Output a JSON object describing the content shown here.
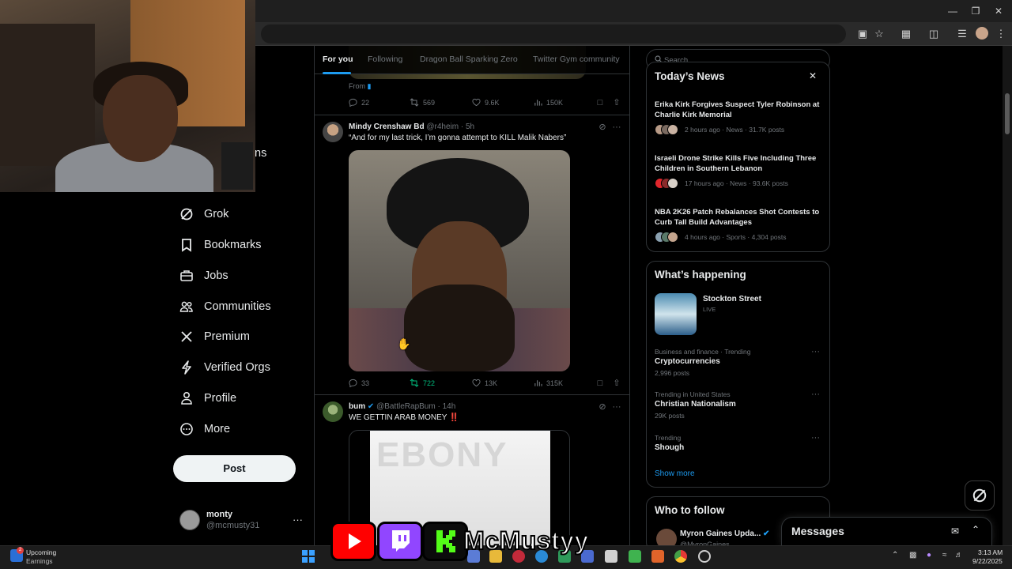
{
  "nav": {
    "partial_label": "ns",
    "items": [
      {
        "label": "Grok",
        "icon": "grok-icon"
      },
      {
        "label": "Bookmarks",
        "icon": "bookmark-icon"
      },
      {
        "label": "Jobs",
        "icon": "briefcase-icon"
      },
      {
        "label": "Communities",
        "icon": "communities-icon"
      },
      {
        "label": "Premium",
        "icon": "x-logo-icon"
      },
      {
        "label": "Verified Orgs",
        "icon": "lightning-icon"
      },
      {
        "label": "Profile",
        "icon": "person-icon"
      },
      {
        "label": "More",
        "icon": "more-circle-icon"
      }
    ],
    "post_label": "Post",
    "account": {
      "name": "monty",
      "handle": "@mcmusty31"
    }
  },
  "feed": {
    "tabs": [
      "For you",
      "Following",
      "Dragon Ball Sparking Zero",
      "Twitter Gym community"
    ],
    "top_post": {
      "from_label": "From",
      "replies": "22",
      "reposts": "569",
      "likes": "9.6K",
      "views": "150K"
    },
    "posts": [
      {
        "name": "Mindy Crenshaw Bd",
        "handle": "@r4heim",
        "time": "· 5h",
        "text": "“And for my last trick, I’m gonna attempt to KILL Malik Nabers”",
        "replies": "33",
        "reposts": "722",
        "likes": "13K",
        "views": "315K"
      },
      {
        "name": "bum",
        "handle": "@BattleRapBum",
        "time": "· 14h",
        "text": "WE GETTIN ARAB MONEY ‼️",
        "media_word": "EBONY"
      }
    ]
  },
  "sidebar": {
    "search_placeholder": "Search",
    "news": {
      "title": "Today’s News",
      "items": [
        {
          "title": "Erika Kirk Forgives Suspect Tyler Robinson at Charlie Kirk Memorial",
          "meta": "2 hours ago · News · 31.7K posts"
        },
        {
          "title": "Israeli Drone Strike Kills Five Including Three Children in Southern Lebanon",
          "meta": "17 hours ago · News · 93.6K posts"
        },
        {
          "title": "NBA 2K26 Patch Rebalances Shot Contests to Curb Tall Build Advantages",
          "meta": "4 hours ago · Sports · 4,304 posts"
        }
      ]
    },
    "happening": {
      "title": "What’s happening",
      "live": {
        "title": "Stockton Street",
        "badge": "LIVE"
      },
      "trends": [
        {
          "context": "Business and finance · Trending",
          "name": "Cryptocurrencies",
          "posts": "2,996 posts"
        },
        {
          "context": "Trending in United States",
          "name": "Christian Nationalism",
          "posts": "29K posts"
        },
        {
          "context": "Trending",
          "name": "Shough",
          "posts": ""
        }
      ],
      "show_more": "Show more"
    },
    "follow": {
      "title": "Who to follow",
      "first": {
        "name": "Myron Gaines Upda...",
        "handle": "@MyronGaines"
      }
    }
  },
  "messages_label": "Messages",
  "overlay": {
    "channel_name": "McMustyy"
  },
  "taskbar": {
    "widget_title": "Upcoming",
    "widget_sub": "Earnings",
    "widget_badge": "2",
    "time": "3:13 AM",
    "date": "9/22/2025"
  },
  "colors": {
    "accent": "#1d9bf0",
    "repost_on": "#00ba7c",
    "youtube": "#ff0000",
    "twitch": "#9146ff",
    "kick": "#53fc18"
  }
}
